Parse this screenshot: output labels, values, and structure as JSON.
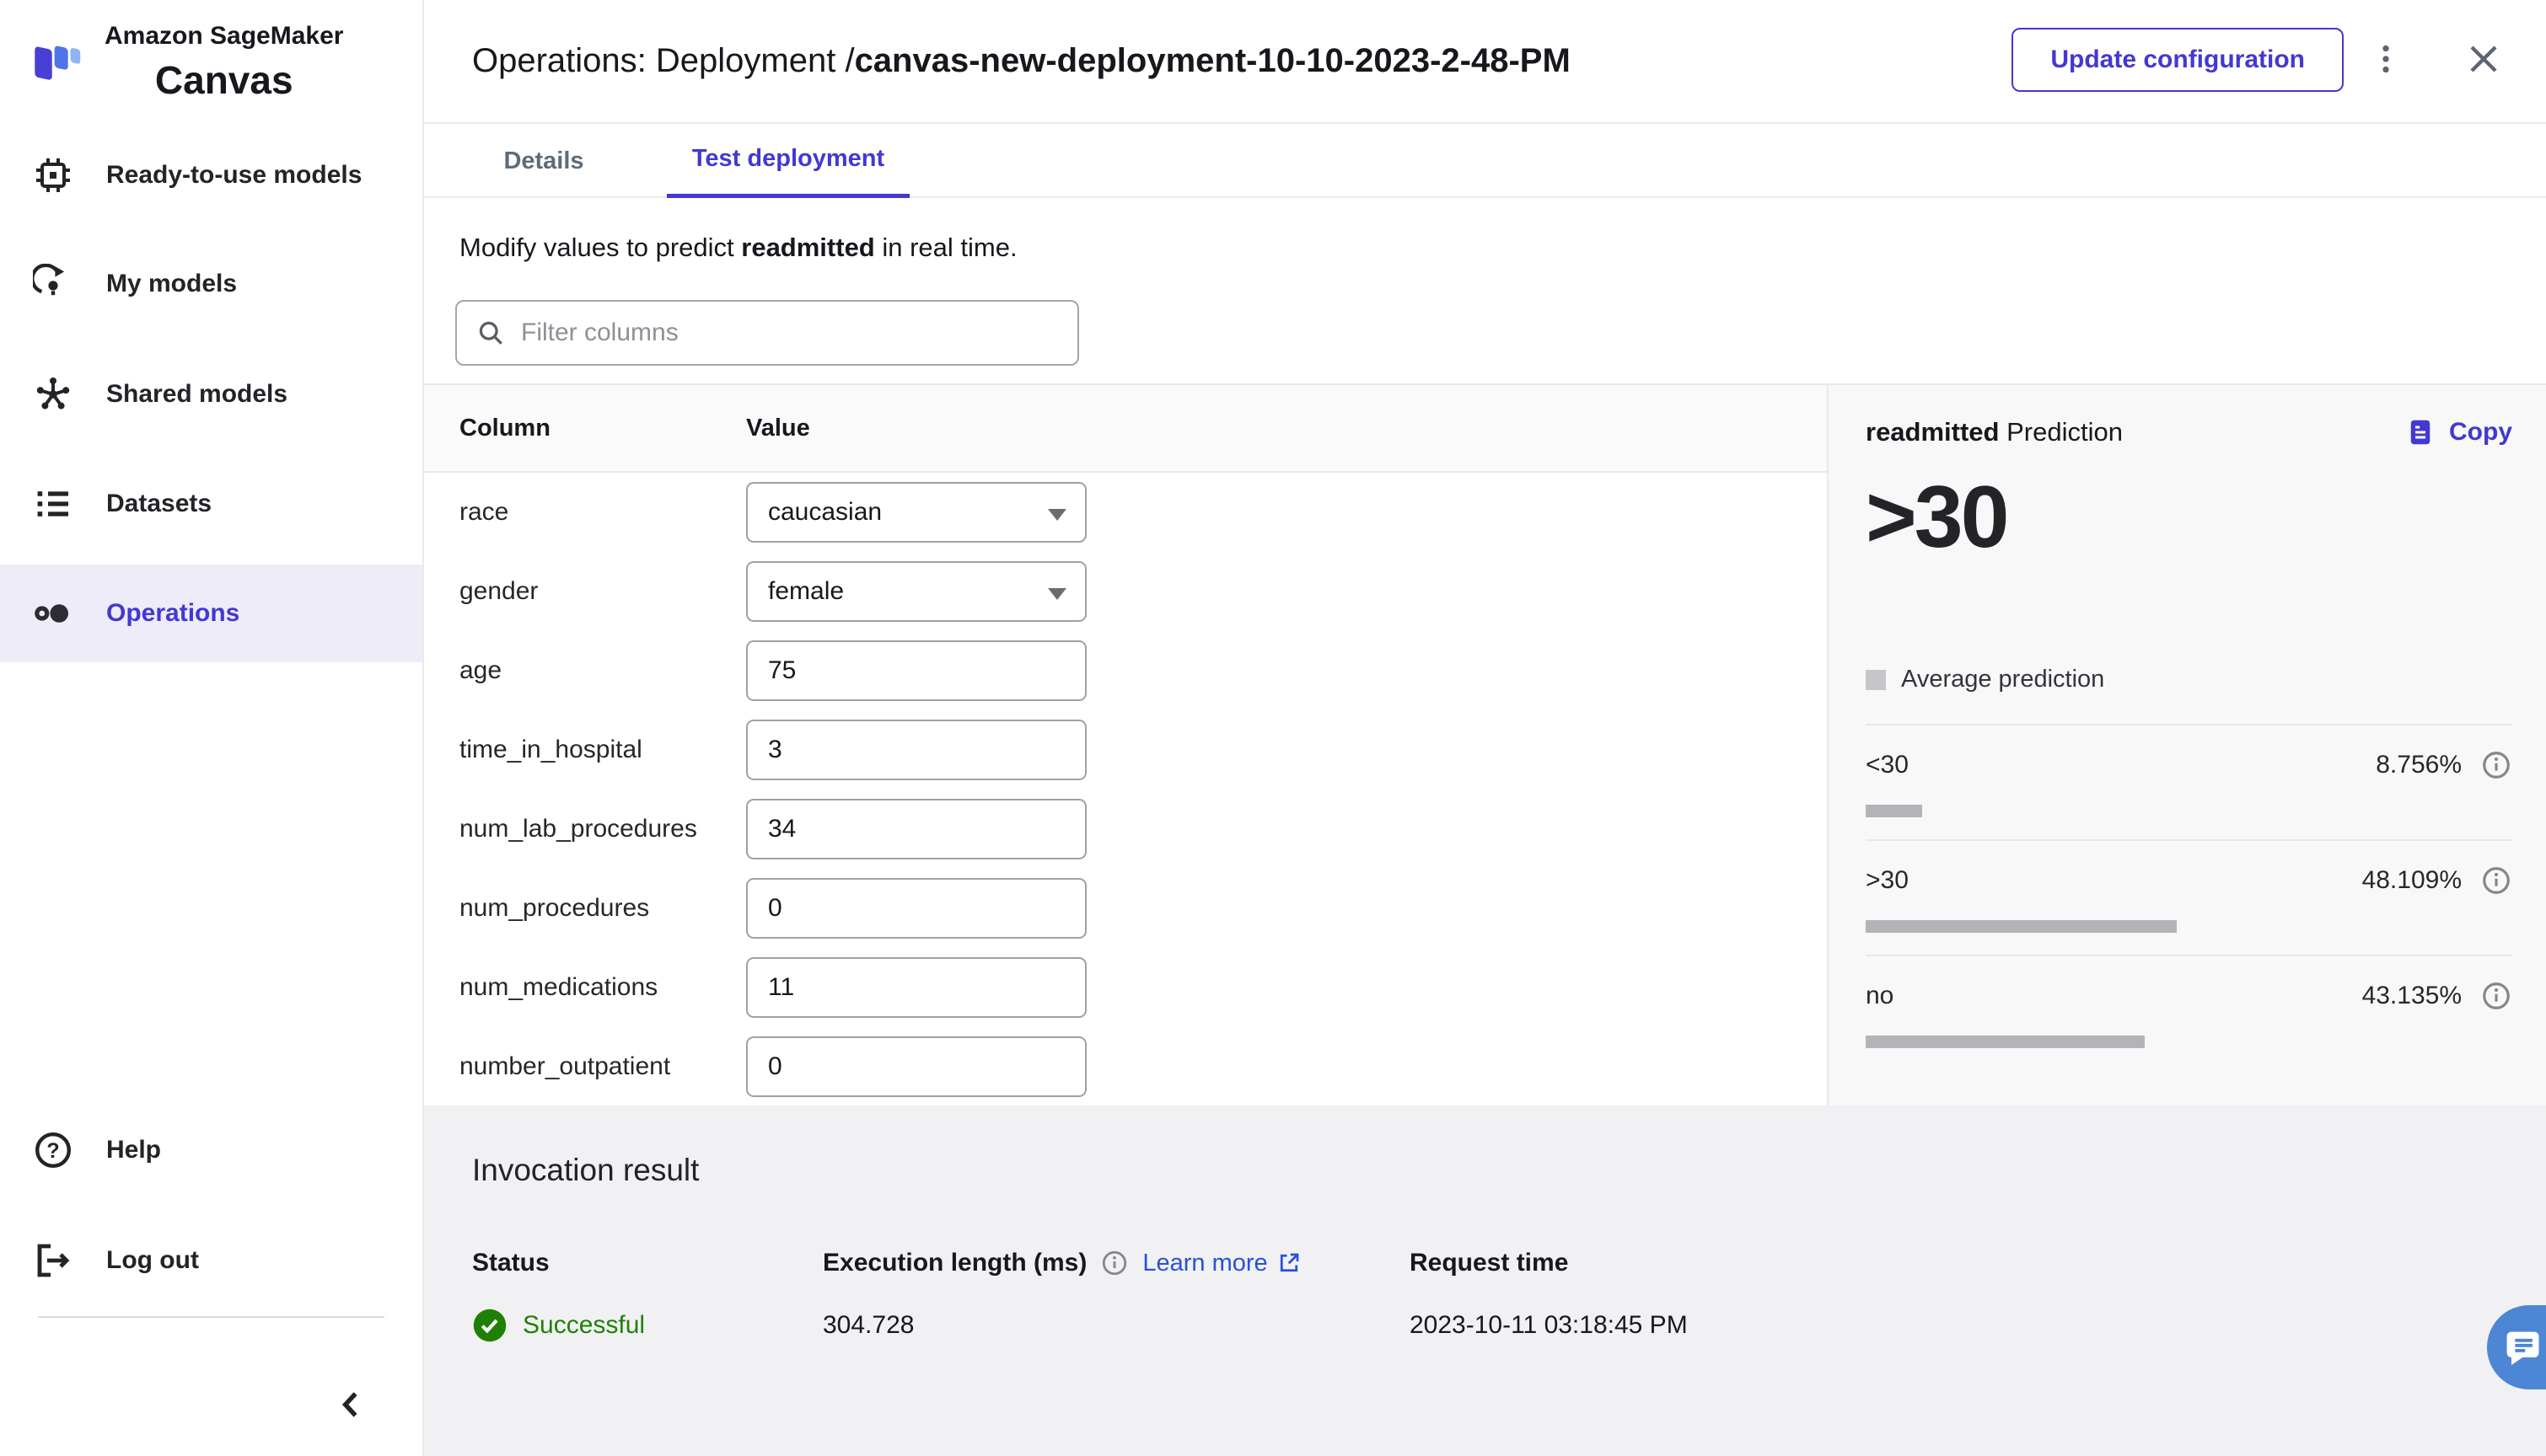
{
  "brand": {
    "line1": "Amazon SageMaker",
    "line2": "Canvas"
  },
  "sidebar": {
    "items": [
      {
        "label": "Ready-to-use models"
      },
      {
        "label": "My models"
      },
      {
        "label": "Shared models"
      },
      {
        "label": "Datasets"
      },
      {
        "label": "Operations"
      }
    ],
    "help": "Help",
    "logout": "Log out"
  },
  "header": {
    "title_prefix": "Operations: Deployment / ",
    "title_name": "canvas-new-deployment-10-10-2023-2-48-PM",
    "update_button": "Update configuration"
  },
  "tabs": {
    "details": "Details",
    "test": "Test deployment"
  },
  "content": {
    "description_prefix": "Modify values to predict ",
    "description_bold": "readmitted",
    "description_suffix": " in real time.",
    "filter_placeholder": "Filter columns",
    "col_header": "Column",
    "val_header": "Value"
  },
  "rows": [
    {
      "column": "race",
      "value": "caucasian",
      "control": "select"
    },
    {
      "column": "gender",
      "value": "female",
      "control": "select"
    },
    {
      "column": "age",
      "value": "75",
      "control": "input"
    },
    {
      "column": "time_in_hospital",
      "value": "3",
      "control": "input"
    },
    {
      "column": "num_lab_procedures",
      "value": "34",
      "control": "input"
    },
    {
      "column": "num_procedures",
      "value": "0",
      "control": "input"
    },
    {
      "column": "num_medications",
      "value": "11",
      "control": "input"
    },
    {
      "column": "number_outpatient",
      "value": "0",
      "control": "input"
    }
  ],
  "prediction": {
    "title_bold": "readmitted",
    "title_rest": " Prediction",
    "copy_label": "Copy",
    "value": ">30",
    "legend": "Average prediction",
    "rows": [
      {
        "label": "<30",
        "pct": "8.756%",
        "width": 8.756
      },
      {
        "label": ">30",
        "pct": "48.109%",
        "width": 48.109
      },
      {
        "label": "no",
        "pct": "43.135%",
        "width": 43.135
      }
    ]
  },
  "invocation": {
    "title": "Invocation result",
    "status_header": "Status",
    "exec_header": "Execution length (ms)",
    "learn_more": "Learn more",
    "request_header": "Request time",
    "status_value": "Successful",
    "exec_value": "304.728",
    "request_value": "2023-10-11 03:18:45 PM"
  },
  "colors": {
    "accent": "#4338d2",
    "link": "#2950d9",
    "success": "#1f8104",
    "chat_bubble": "#4d86d5",
    "bar": "#b4b4b8",
    "selected_bg": "#eeecf8"
  }
}
